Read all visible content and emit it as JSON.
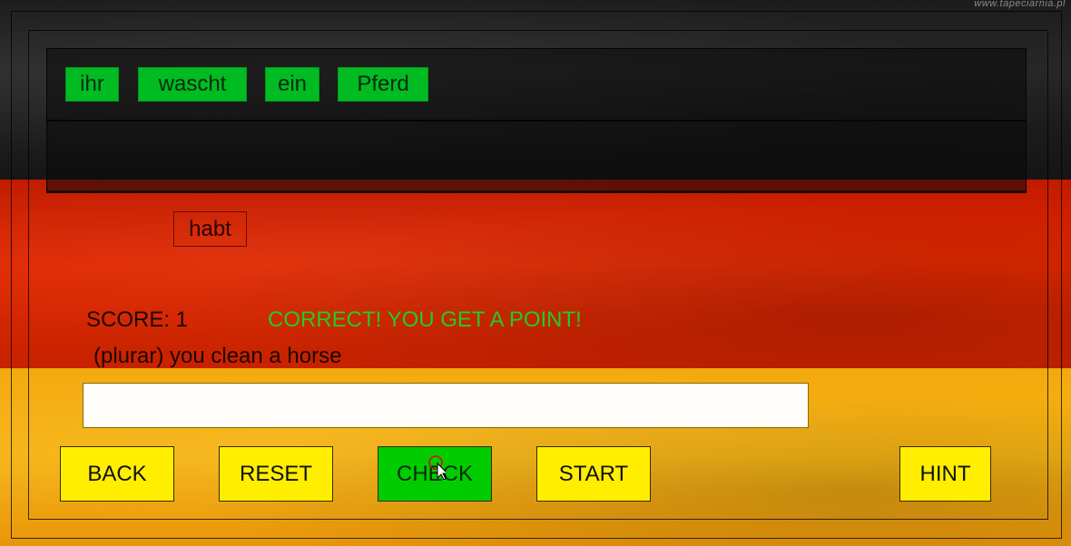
{
  "watermark": "www.tapeciarnia.pl",
  "answer_tiles": [
    "ihr",
    "wascht",
    "ein",
    "Pferd"
  ],
  "extra_tiles": [
    "habt"
  ],
  "score": {
    "label": "SCORE: 1"
  },
  "feedback": "CORRECT! YOU GET A POINT!",
  "prompt": "(plurar) you clean a horse",
  "input": {
    "value": "",
    "placeholder": ""
  },
  "buttons": {
    "back": "BACK",
    "reset": "RESET",
    "check": "CHECK",
    "start": "START",
    "hint": "HINT"
  },
  "colors": {
    "flag_black": "#1c1c1c",
    "flag_red": "#e02800",
    "flag_gold": "#f6b414",
    "tile_green": "#00bb22",
    "feedback_green": "#22cc22",
    "button_yellow": "#ffee00",
    "check_button_green": "#00cc00"
  },
  "icons": {
    "cursor": "mouse-pointer-icon"
  }
}
